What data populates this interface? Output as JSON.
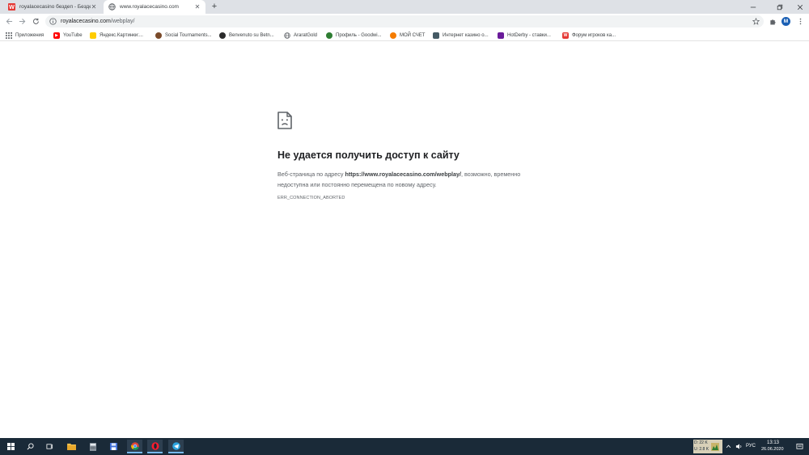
{
  "tabs": [
    {
      "title": "royalacecasino бездеп - Бездеп",
      "favicon": "w-icon",
      "active": false
    },
    {
      "title": "www.royalacecasino.com",
      "favicon": "globe-icon",
      "active": true
    }
  ],
  "toolbar": {
    "url_host": "royalacecasino.com",
    "url_path": "/webplay/",
    "profile_initial": "M"
  },
  "bookmarks": [
    {
      "label": "Приложения",
      "icon": "apps-grid-icon",
      "color": "#5f6368"
    },
    {
      "label": "YouTube",
      "icon": "youtube-icon",
      "color": "#ff0000"
    },
    {
      "label": "Яндекс.Картинки:...",
      "icon": "yandex-images-icon",
      "color": "#ffcc00"
    },
    {
      "label": "Social Tournaments...",
      "icon": "social-tournaments-icon",
      "color": "#7a4a2a"
    },
    {
      "label": "Benvenuto su Betn...",
      "icon": "betn-icon",
      "color": "#2b2b2b"
    },
    {
      "label": "AraratGold",
      "icon": "globe-icon",
      "color": "#5f6368"
    },
    {
      "label": "Профиль - Goodwi...",
      "icon": "goodwin-icon",
      "color": "#2e7d32"
    },
    {
      "label": "МОЙ СЧЕТ",
      "icon": "account-icon",
      "color": "#f57c00"
    },
    {
      "label": "Интернет казино о...",
      "icon": "casino-icon",
      "color": "#455a64"
    },
    {
      "label": "HotDerby - ставки...",
      "icon": "hotderby-icon",
      "color": "#6a1b9a"
    },
    {
      "label": "Форум игроков ка...",
      "icon": "w-icon",
      "color": "#e53935"
    }
  ],
  "error": {
    "title": "Не удается получить доступ к сайту",
    "desc_prefix": "Веб-страница по адресу ",
    "desc_url": "https://www.royalacecasino.com/webplay/",
    "desc_suffix": ", возможно, временно недоступна или постоянно перемещена по новому адресу.",
    "code": "ERR_CONNECTION_ABORTED"
  },
  "taskbar": {
    "apps": [
      "windows-start-icon",
      "search-icon",
      "task-view-icon",
      "file-explorer-icon",
      "calculator-icon",
      "save-disk-icon",
      "chrome-icon",
      "opera-icon",
      "telegram-icon"
    ],
    "net_up": "D: 22 K",
    "net_down": "U: 2.8 K",
    "language": "РУС",
    "time": "13:13",
    "date": "26.06.2020"
  }
}
